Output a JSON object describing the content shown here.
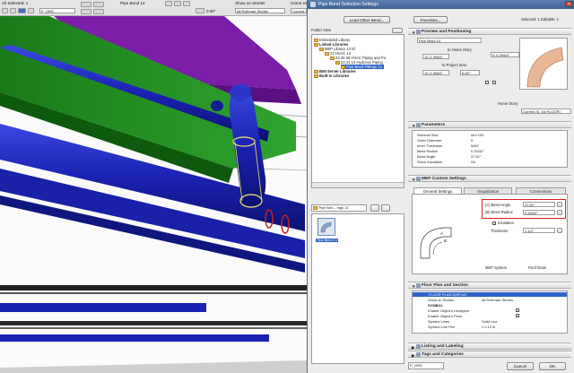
{
  "toolbar": {
    "selection": "All Selected: 1",
    "tool": "Pipe Bend 14",
    "layer": "P_ORD",
    "angle": "0.00°",
    "show_on_stories_label": "Show on Stories",
    "show_on_stories_value": "All Relevant Stories",
    "home_story_label": "Home Sto",
    "home_story_value": "Current"
  },
  "dialog": {
    "title": "Pipe Bend Selection Settings",
    "load_other_button": "Load Other Bend...",
    "favorites_button": "Favorites...",
    "selected_info": "Selected: 1 Editable: 1",
    "folder_view": "Folder View",
    "tree": [
      "Embedded Library",
      "Linked Libraries",
      "MEP Library 14.lcf",
      "23 HVAC 14",
      "23 20 00 HVAC Piping and Pu",
      "23 21 13 Hydronic Piping",
      "Pipe Bend Fittings 14",
      "BIM Server Libraries",
      "Built-in Libraries"
    ],
    "path_dropdown": "Pipe Ben... ings 14",
    "thumb_label": "Pipe Bend 14",
    "preview": {
      "title": "Preview and Positioning",
      "object_name": "Pipe Bend 14",
      "to_home_story_label": "to Home Story",
      "to_home_story_value": "11'-2 39/64\"",
      "to_project_zero_label": "to Project Zero",
      "to_project_zero_value": "11'-2 39/64\"",
      "angle_value": "0.00°",
      "size_value": "0'-6 39/64\"",
      "home_story_label": "Home Story:",
      "home_story_value": "Current (0. 1st FLOOR)"
    },
    "parameters": {
      "title": "Parameters",
      "rows": [
        {
          "label": "Nominal Size",
          "value": "mm 100"
        },
        {
          "label": "Outer Diameter",
          "value": "0'"
        },
        {
          "label": "Inner Thickness",
          "value": "9/64\""
        },
        {
          "label": "Bend Radius",
          "value": "0 29/32\""
        },
        {
          "label": "Bend Angle",
          "value": "37.61°"
        },
        {
          "label": "Show Insulation",
          "value": "On"
        }
      ]
    },
    "mep": {
      "title": "MEP Custom Settings",
      "tabs": [
        "General Settings",
        "Visualization",
        "Connections"
      ],
      "bend_angle_label": "(A) Bend Angle",
      "bend_angle_value": "37.61°",
      "bend_radius_label": "(B) Bend Radius",
      "bend_radius_value": "0 29/32\"",
      "insulation_label": "Insulation",
      "thickness_label": "Thickness",
      "thickness_value": "1 1/2\"",
      "mep_system_label": "MEP System",
      "mep_system_value": "Roof Drain",
      "diagram_a": "A",
      "diagram_b": "B"
    },
    "floorplan": {
      "title": "Floor Plan and Section",
      "rows": [
        {
          "label": "FLOOR PLAN DISPLAY",
          "value": ""
        },
        {
          "label": "Show on Stories",
          "value": "All Relevant Stories"
        },
        {
          "label": "SYMBOL",
          "value": ""
        },
        {
          "label": "Enable Object's Linetypes",
          "value": ""
        },
        {
          "label": "Enable Object's Pens",
          "value": ""
        },
        {
          "label": "Symbol Lines",
          "value": "Solid Line"
        },
        {
          "label": "Symbol Line Pen",
          "value": "1  0.13 lb"
        }
      ]
    },
    "listing_title": "Listing and Labeling",
    "tags_title": "Tags and Categories",
    "footer_layer": "P_ORD",
    "cancel_button": "Cancel",
    "ok_button": "OK"
  }
}
